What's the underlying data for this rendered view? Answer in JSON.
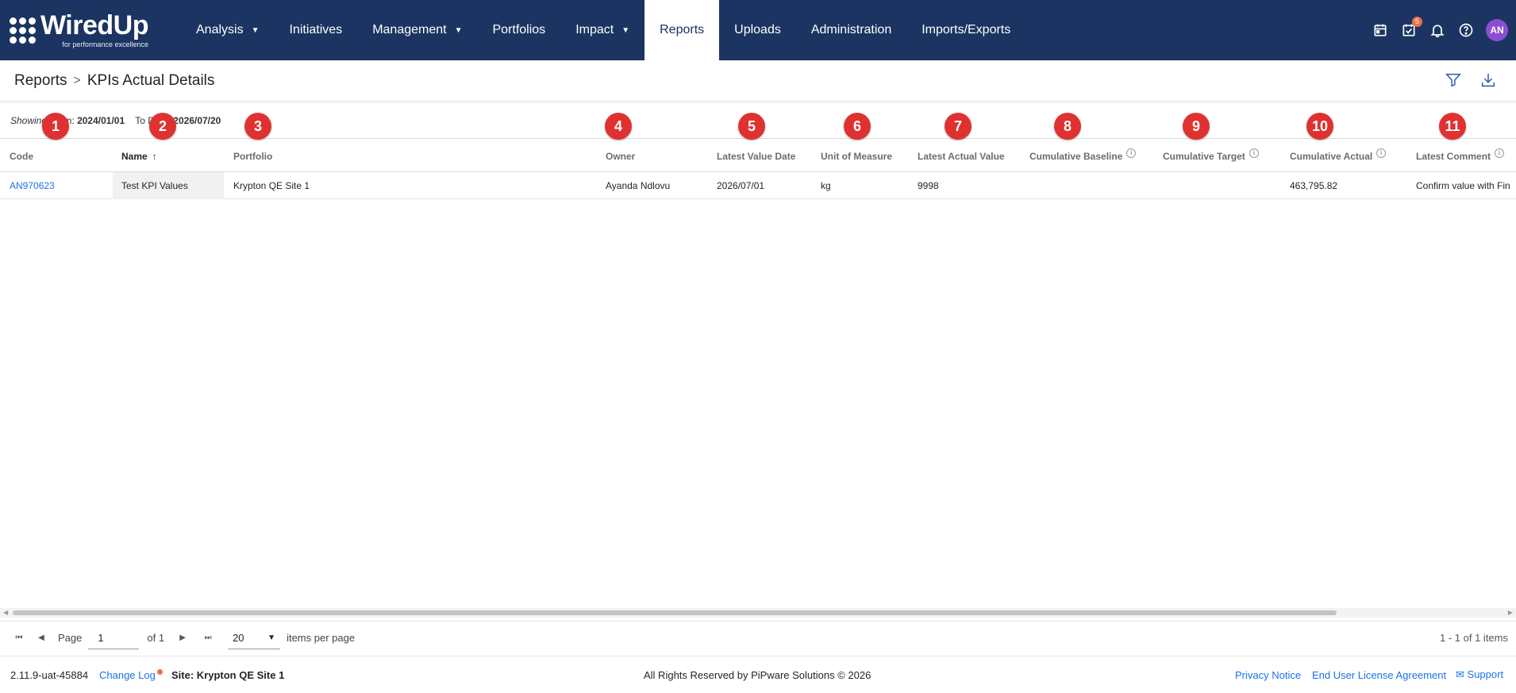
{
  "app": {
    "logo": {
      "name": "WiredUp",
      "tagline": "for performance excellence"
    }
  },
  "nav": {
    "items": [
      {
        "label": "Analysis",
        "dropdown": true
      },
      {
        "label": "Initiatives",
        "dropdown": false
      },
      {
        "label": "Management",
        "dropdown": true
      },
      {
        "label": "Portfolios",
        "dropdown": false
      },
      {
        "label": "Impact",
        "dropdown": true
      },
      {
        "label": "Reports",
        "dropdown": false,
        "active": true
      },
      {
        "label": "Uploads",
        "dropdown": false
      },
      {
        "label": "Administration",
        "dropdown": false
      },
      {
        "label": "Imports/Exports",
        "dropdown": false
      }
    ],
    "tasks_badge": "5",
    "avatar_initials": "AN"
  },
  "header": {
    "breadcrumb_root": "Reports",
    "breadcrumb_current": "KPIs Actual Details"
  },
  "filter": {
    "showing_label": "Showing",
    "from_label": "From:",
    "from_value": "2024/01/01",
    "to_label": "To Date:",
    "to_value": "2026/07/20"
  },
  "markers": [
    "1",
    "2",
    "3",
    "4",
    "5",
    "6",
    "7",
    "8",
    "9",
    "10",
    "11"
  ],
  "table": {
    "columns": [
      "Code",
      "Name",
      "Portfolio",
      "Owner",
      "Latest Value Date",
      "Unit of Measure",
      "Latest Actual Value",
      "Cumulative Baseline",
      "Cumulative Target",
      "Cumulative Actual",
      "Latest Comment"
    ],
    "rows": [
      {
        "code": "AN970623",
        "name": "Test KPI Values",
        "portfolio": "Krypton QE Site 1",
        "owner": "Ayanda Ndlovu",
        "latest_value_date": "2026/07/01",
        "unit": "kg",
        "latest_actual": "9998",
        "cum_baseline": "",
        "cum_target": "",
        "cum_actual": "463,795.82",
        "latest_comment": "Confirm value with Fin"
      }
    ]
  },
  "pager": {
    "page_label": "Page",
    "page_value": "1",
    "of_label": "of 1",
    "per_page": "20",
    "per_page_label": "items per page",
    "summary": "1 - 1 of 1 items"
  },
  "footer": {
    "version": "2.11.9-uat-45884",
    "change_log": "Change Log",
    "site": "Site: Krypton QE Site 1",
    "copyright": "All Rights Reserved by PiPware Solutions © 2026",
    "privacy": "Privacy Notice",
    "eula": "End User License Agreement",
    "support": "Support"
  }
}
